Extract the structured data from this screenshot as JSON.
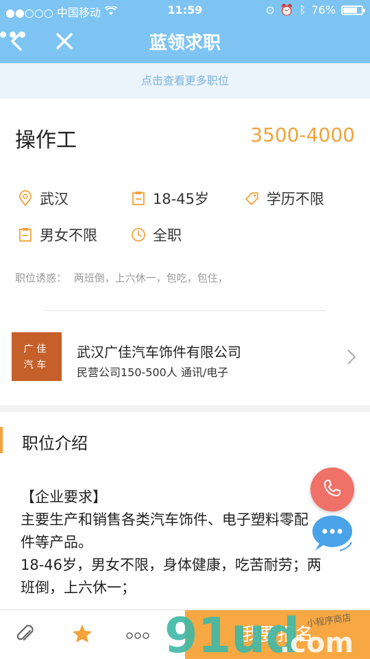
{
  "status": {
    "carrier": "●●○○○ 中国移动",
    "time": "11:59",
    "battery": "76%"
  },
  "navbar": {
    "title": "蓝领求职"
  },
  "banner": {
    "more_jobs": "点击查看更多职位"
  },
  "job": {
    "title": "操作工",
    "salary": "3500-4000",
    "location": "武汉",
    "age": "18-45岁",
    "education": "学历不限",
    "gender": "男女不限",
    "type": "全职",
    "perks_label": "职位诱惑：",
    "perks": "两班倒，上六休一，包吃，包住，"
  },
  "company": {
    "logo_line1": "广佳",
    "logo_line2": "汽车",
    "name": "武汉广佳汽车饰件有限公司",
    "info": "民营公司150-500人 通讯/电子"
  },
  "intro": {
    "heading": "职位介绍",
    "line1": "【企业要求】",
    "line2": "主要生产和销售各类汽车饰件、电子塑料零配",
    "line3": "件等产品。",
    "line4": "18-46岁，男女不限，身体健康，吃苦耐劳；两",
    "line5": "班倒，上六休一；"
  },
  "bottom": {
    "apply": "我要报名"
  },
  "watermark": {
    "text": "91ud.com",
    "subtext": "小程序商店"
  },
  "colors": {
    "accent": "#f2a33a",
    "nav": "#7dc4f2",
    "apply": "#f7a842",
    "phone": "#f07167",
    "chat": "#4aa3e8"
  },
  "battery_level": 0.76
}
